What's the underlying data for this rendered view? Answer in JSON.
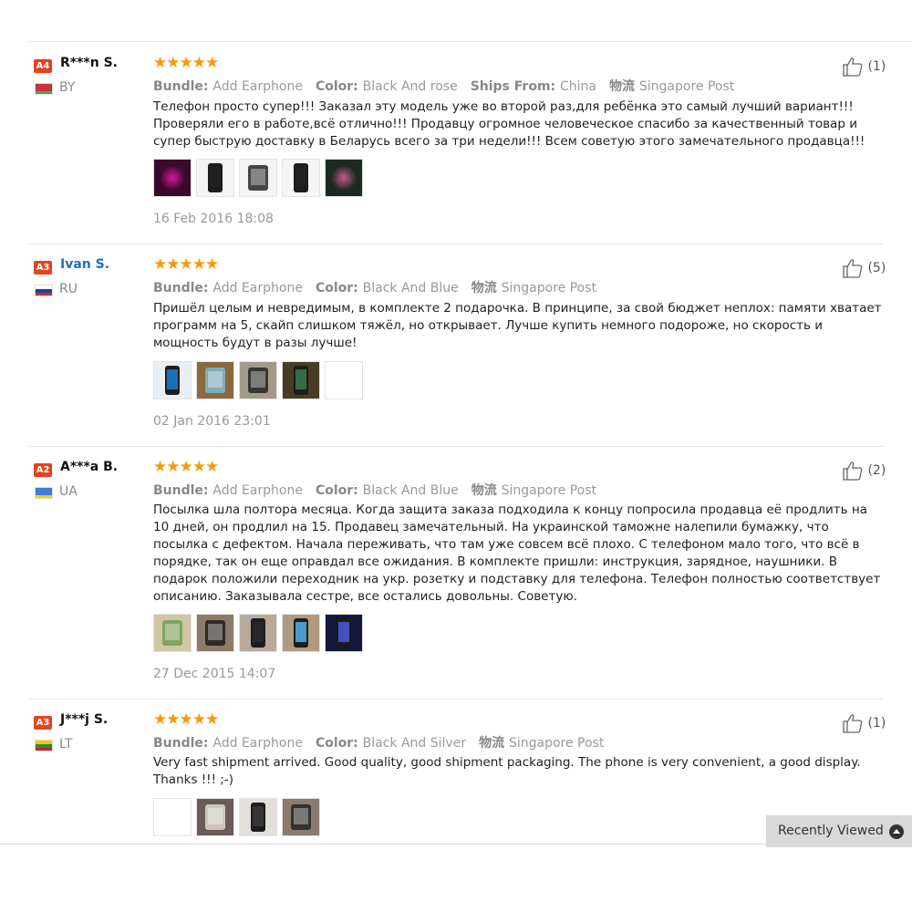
{
  "labels": {
    "bundle": "Bundle:",
    "color": "Color:",
    "ships_from": "Ships From:",
    "logistics": "物流"
  },
  "recently_viewed": "Recently Viewed",
  "reviews": [
    {
      "level": "A4",
      "name": "R***n S.",
      "name_is_link": false,
      "country": "BY",
      "flag": [
        "#c8313e",
        "#c8313e",
        "#4aa657"
      ],
      "rating": 5,
      "stars": "★★★★★",
      "bundle": "Add Earphone",
      "color": "Black And rose",
      "ships_from": "China",
      "logistics": "Singapore Post",
      "text": "Телефон просто супер!!! Заказал эту модель уже во второй раз,для ребёнка это самый лучший вариант!!! Проверяли его в работе,всё отлично!!! Продавцу огромное человеческое спасибо за качественный товар и супер быструю доставку в Беларусь всего за три недели!!! Всем советую этого замечательного продавца!!!",
      "photos": [
        {
          "bg": "#3a0a2a",
          "fg": "#d61a9c",
          "style": "glow"
        },
        {
          "bg": "#f4f4f4",
          "fg": "#222",
          "style": "phone"
        },
        {
          "bg": "#f4f4f4",
          "fg": "#333",
          "style": "phone-wide"
        },
        {
          "bg": "#f6f6f6",
          "fg": "#222",
          "style": "phone"
        },
        {
          "bg": "#1d2a22",
          "fg": "#c35a8a",
          "style": "glow"
        }
      ],
      "date": "16 Feb 2016 18:08",
      "likes": "(1)"
    },
    {
      "level": "A3",
      "name": "Ivan S.",
      "name_is_link": true,
      "country": "RU",
      "flag": [
        "#ffffff",
        "#1c3fa8",
        "#d52b1e"
      ],
      "rating": 5,
      "stars": "★★★★★",
      "bundle": "Add Earphone",
      "color": "Black And Blue",
      "ships_from": "",
      "logistics": "Singapore Post",
      "text": "Пришёл целым и невредимым, в комплекте 2 подарочка. В принципе, за свой бюджет неплох: памяти хватает программ на 5, скайп слишком тяжёл, но открывает. Лучше купить немного подороже, но скорость и мощность будут в разы лучше!",
      "photos": [
        {
          "bg": "#e9eef2",
          "fg": "#1a7fd0",
          "style": "phone"
        },
        {
          "bg": "#8a6a3c",
          "fg": "#7fb3c8",
          "style": "phone-wide"
        },
        {
          "bg": "#a49a8a",
          "fg": "#2b2b2b",
          "style": "phone-wide"
        },
        {
          "bg": "#4a3b25",
          "fg": "#3a7a4a",
          "style": "phone"
        },
        {
          "bg": "#ffffff",
          "fg": "#ffffff",
          "style": "blank"
        }
      ],
      "date": "02 Jan 2016 23:01",
      "likes": "(5)"
    },
    {
      "level": "A2",
      "name": "A***a B.",
      "name_is_link": false,
      "country": "UA",
      "flag": [
        "#3a7fd5",
        "#3a7fd5",
        "#f5d300"
      ],
      "rating": 5,
      "stars": "★★★★★",
      "bundle": "Add Earphone",
      "color": "Black And Blue",
      "ships_from": "",
      "logistics": "Singapore Post",
      "text": "Посылка шла полтора месяца. Когда защита заказа подходила к концу попросила продавца её продлить на 10 дней, он продлил на 15. Продавец замечательный. На украинской таможне налепили бумажку, что посылка с дефектом. Начала переживать, что там уже совсем всё плохо. С телефоном мало того, что всё в порядке, так он еще оправдал все ожидания. В комплекте пришли: инструкция, зарядное, наушники. В подарок положили переходник на укр. розетку и подставку для телефона. Телефон полностью соответствует описанию. Заказывала сестре, все остались довольны. Советую.",
      "photos": [
        {
          "bg": "#cfc7a4",
          "fg": "#7aa05a",
          "style": "phone-wide"
        },
        {
          "bg": "#8c7b68",
          "fg": "#222",
          "style": "phone-wide"
        },
        {
          "bg": "#b7aa9a",
          "fg": "#2a2a2a",
          "style": "phone"
        },
        {
          "bg": "#b09a80",
          "fg": "#4fb2e6",
          "style": "phone"
        },
        {
          "bg": "#14163a",
          "fg": "#4a5ad8",
          "style": "phone"
        }
      ],
      "date": "27 Dec 2015 14:07",
      "likes": "(2)"
    },
    {
      "level": "A3",
      "name": "J***j S.",
      "name_is_link": false,
      "country": "LT",
      "flag": [
        "#f7c800",
        "#2a8a3a",
        "#c3272b"
      ],
      "rating": 5,
      "stars": "★★★★★",
      "bundle": "Add Earphone",
      "color": "Black And Silver",
      "ships_from": "",
      "logistics": "Singapore Post",
      "text": "Very fast shipment arrived. Good quality, good shipment packaging. The phone is very convenient, a good display. Thanks !!! ;-)",
      "photos": [
        {
          "bg": "#ffffff",
          "fg": "#ffffff",
          "style": "blank"
        },
        {
          "bg": "#6a5a58",
          "fg": "#d8d2cc",
          "style": "phone-wide"
        },
        {
          "bg": "#e3e0dc",
          "fg": "#3a3a3a",
          "style": "phone"
        },
        {
          "bg": "#8a7a70",
          "fg": "#2a2a2a",
          "style": "phone-wide"
        }
      ],
      "date": "",
      "likes": "(1)"
    }
  ]
}
